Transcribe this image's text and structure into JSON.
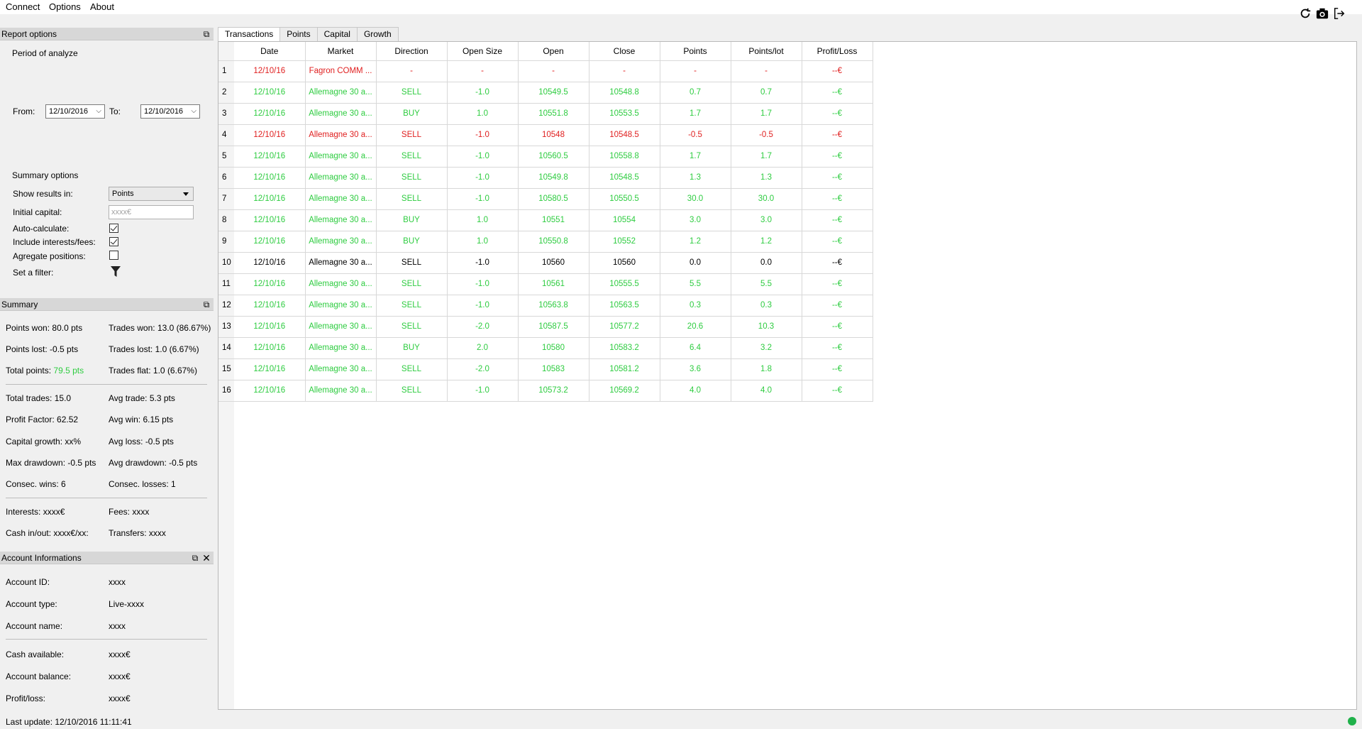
{
  "menu": {
    "connect": "Connect",
    "options": "Options",
    "about": "About"
  },
  "report_options": {
    "title": "Report options",
    "period_label": "Period of analyze",
    "from_label": "From:",
    "from_value": "12/10/2016",
    "to_label": "To:",
    "to_value": "12/10/2016",
    "summary_options_label": "Summary options",
    "show_results_label": "Show results in:",
    "show_results_value": "Points",
    "initial_capital_label": "Initial capital:",
    "initial_capital_placeholder": "xxxx€",
    "auto_calc_label": "Auto-calculate:",
    "auto_calc_checked": true,
    "include_fees_label": "Include interests/fees:",
    "include_fees_checked": true,
    "aggregate_label": "Agregate positions:",
    "aggregate_checked": false,
    "filter_label": "Set a filter:"
  },
  "summary": {
    "title": "Summary",
    "points_won_label": "Points won:",
    "points_won": "80.0 pts",
    "trades_won_label": "Trades won:",
    "trades_won": "13.0 (86.67%)",
    "points_lost_label": "Points lost:",
    "points_lost": "-0.5 pts",
    "trades_lost_label": "Trades lost:",
    "trades_lost": "1.0 (6.67%)",
    "total_points_label": "Total points:",
    "total_points": "79.5 pts",
    "trades_flat_label": "Trades flat:",
    "trades_flat": "1.0 (6.67%)",
    "total_trades_label": "Total trades:",
    "total_trades": "15.0",
    "avg_trade_label": "Avg trade:",
    "avg_trade": "5.3 pts",
    "profit_factor_label": "Profit Factor:",
    "profit_factor": "62.52",
    "avg_win_label": "Avg win:",
    "avg_win": "6.15 pts",
    "capital_growth_label": "Capital growth:",
    "capital_growth": "xx%",
    "avg_loss_label": "Avg loss:",
    "avg_loss": "-0.5 pts",
    "max_drawdown_label": "Max drawdown:",
    "max_drawdown": "-0.5 pts",
    "avg_drawdown_label": "Avg drawdown:",
    "avg_drawdown": "-0.5 pts",
    "consec_wins_label": "Consec. wins:",
    "consec_wins": "6",
    "consec_losses_label": "Consec. losses:",
    "consec_losses": "1",
    "interests_label": "Interests:",
    "interests": "xxxx€",
    "fees_label": "Fees:",
    "fees": "xxxx",
    "cash_inout_label": "Cash in/out:",
    "cash_inout": "xxxx€/xx:",
    "transfers_label": "Transfers:",
    "transfers": "xxxx"
  },
  "account": {
    "title": "Account Informations",
    "id_label": "Account ID:",
    "id": "xxxx",
    "type_label": "Account type:",
    "type": "Live-xxxx",
    "name_label": "Account name:",
    "name": "xxxx",
    "cash_label": "Cash available:",
    "cash": "xxxx€",
    "balance_label": "Account balance:",
    "balance": "xxxx€",
    "pl_label": "Profit/loss:",
    "pl": "xxxx€"
  },
  "status": {
    "last_update": "Last update: 12/10/2016 11:11:41",
    "status_color": "#1fb14a"
  },
  "tabs": [
    "Transactions",
    "Points",
    "Capital",
    "Growth"
  ],
  "colors": {
    "win": "#2ecc40",
    "loss": "#e02020",
    "flat": "#000000"
  },
  "table": {
    "columns": [
      "Date",
      "Market",
      "Direction",
      "Open Size",
      "Open",
      "Close",
      "Points",
      "Points/lot",
      "Profit/Loss"
    ],
    "rows": [
      {
        "n": "1",
        "c": "loss",
        "v": [
          "12/10/16",
          "Fagron COMM ...",
          "-",
          "-",
          "-",
          "-",
          "-",
          "-",
          "--€"
        ]
      },
      {
        "n": "2",
        "c": "win",
        "v": [
          "12/10/16",
          "Allemagne 30 a...",
          "SELL",
          "-1.0",
          "10549.5",
          "10548.8",
          "0.7",
          "0.7",
          "--€"
        ]
      },
      {
        "n": "3",
        "c": "win",
        "v": [
          "12/10/16",
          "Allemagne 30 a...",
          "BUY",
          "1.0",
          "10551.8",
          "10553.5",
          "1.7",
          "1.7",
          "--€"
        ]
      },
      {
        "n": "4",
        "c": "loss",
        "v": [
          "12/10/16",
          "Allemagne 30 a...",
          "SELL",
          "-1.0",
          "10548",
          "10548.5",
          "-0.5",
          "-0.5",
          "--€"
        ]
      },
      {
        "n": "5",
        "c": "win",
        "v": [
          "12/10/16",
          "Allemagne 30 a...",
          "SELL",
          "-1.0",
          "10560.5",
          "10558.8",
          "1.7",
          "1.7",
          "--€"
        ]
      },
      {
        "n": "6",
        "c": "win",
        "v": [
          "12/10/16",
          "Allemagne 30 a...",
          "SELL",
          "-1.0",
          "10549.8",
          "10548.5",
          "1.3",
          "1.3",
          "--€"
        ]
      },
      {
        "n": "7",
        "c": "win",
        "v": [
          "12/10/16",
          "Allemagne 30 a...",
          "SELL",
          "-1.0",
          "10580.5",
          "10550.5",
          "30.0",
          "30.0",
          "--€"
        ]
      },
      {
        "n": "8",
        "c": "win",
        "v": [
          "12/10/16",
          "Allemagne 30 a...",
          "BUY",
          "1.0",
          "10551",
          "10554",
          "3.0",
          "3.0",
          "--€"
        ]
      },
      {
        "n": "9",
        "c": "win",
        "v": [
          "12/10/16",
          "Allemagne 30 a...",
          "BUY",
          "1.0",
          "10550.8",
          "10552",
          "1.2",
          "1.2",
          "--€"
        ]
      },
      {
        "n": "10",
        "c": "flat",
        "v": [
          "12/10/16",
          "Allemagne 30 a...",
          "SELL",
          "-1.0",
          "10560",
          "10560",
          "0.0",
          "0.0",
          "--€"
        ]
      },
      {
        "n": "11",
        "c": "win",
        "v": [
          "12/10/16",
          "Allemagne 30 a...",
          "SELL",
          "-1.0",
          "10561",
          "10555.5",
          "5.5",
          "5.5",
          "--€"
        ]
      },
      {
        "n": "12",
        "c": "win",
        "v": [
          "12/10/16",
          "Allemagne 30 a...",
          "SELL",
          "-1.0",
          "10563.8",
          "10563.5",
          "0.3",
          "0.3",
          "--€"
        ]
      },
      {
        "n": "13",
        "c": "win",
        "v": [
          "12/10/16",
          "Allemagne 30 a...",
          "SELL",
          "-2.0",
          "10587.5",
          "10577.2",
          "20.6",
          "10.3",
          "--€"
        ]
      },
      {
        "n": "14",
        "c": "win",
        "v": [
          "12/10/16",
          "Allemagne 30 a...",
          "BUY",
          "2.0",
          "10580",
          "10583.2",
          "6.4",
          "3.2",
          "--€"
        ]
      },
      {
        "n": "15",
        "c": "win",
        "v": [
          "12/10/16",
          "Allemagne 30 a...",
          "SELL",
          "-2.0",
          "10583",
          "10581.2",
          "3.6",
          "1.8",
          "--€"
        ]
      },
      {
        "n": "16",
        "c": "win",
        "v": [
          "12/10/16",
          "Allemagne 30 a...",
          "SELL",
          "-1.0",
          "10573.2",
          "10569.2",
          "4.0",
          "4.0",
          "--€"
        ]
      }
    ]
  }
}
